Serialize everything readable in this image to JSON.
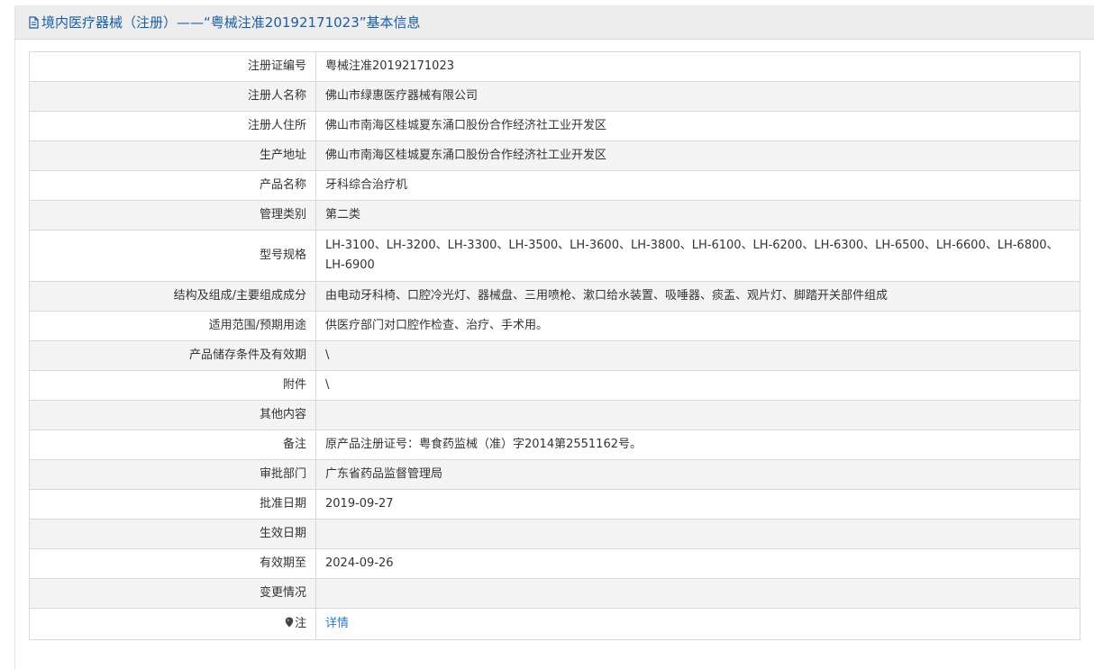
{
  "header": {
    "title": "境内医疗器械（注册）——“粤械注准20192171023”基本信息"
  },
  "rows": [
    {
      "label": "注册证编号",
      "value": "粤械注准20192171023"
    },
    {
      "label": "注册人名称",
      "value": "佛山市绿惠医疗器械有限公司"
    },
    {
      "label": "注册人住所",
      "value": "佛山市南海区桂城夏东涌口股份合作经济社工业开发区"
    },
    {
      "label": "生产地址",
      "value": "佛山市南海区桂城夏东涌口股份合作经济社工业开发区"
    },
    {
      "label": "产品名称",
      "value": "牙科综合治疗机"
    },
    {
      "label": "管理类别",
      "value": "第二类"
    },
    {
      "label": "型号规格",
      "value": "LH-3100、LH-3200、LH-3300、LH-3500、LH-3600、LH-3800、LH-6100、LH-6200、LH-6300、LH-6500、LH-6600、LH-6800、LH-6900"
    },
    {
      "label": "结构及组成/主要组成成分",
      "value": "由电动牙科椅、口腔冷光灯、器械盘、三用喷枪、漱口给水装置、吸唾器、痰盂、观片灯、脚踏开关部件组成"
    },
    {
      "label": "适用范围/预期用途",
      "value": "供医疗部门对口腔作检查、治疗、手术用。"
    },
    {
      "label": "产品储存条件及有效期",
      "value": "\\"
    },
    {
      "label": "附件",
      "value": "\\"
    },
    {
      "label": "其他内容",
      "value": ""
    },
    {
      "label": "备注",
      "value": "原产品注册证号：粤食药监械（准）字2014第2551162号。"
    },
    {
      "label": "审批部门",
      "value": "广东省药品监督管理局"
    },
    {
      "label": "批准日期",
      "value": "2019-09-27"
    },
    {
      "label": "生效日期",
      "value": ""
    },
    {
      "label": "有效期至",
      "value": "2024-09-26"
    },
    {
      "label": "变更情况",
      "value": ""
    }
  ],
  "note": {
    "label": "注",
    "link": "详情"
  }
}
